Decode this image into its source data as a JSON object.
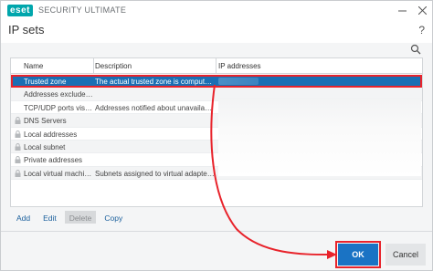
{
  "titlebar": {
    "logo_text": "eset",
    "app_title": "SECURITY ULTIMATE",
    "minimize_icon": "minimize-icon",
    "close_icon": "close-icon"
  },
  "header": {
    "title": "IP sets",
    "help_icon": "help-icon"
  },
  "search": {
    "icon": "search-icon"
  },
  "table": {
    "columns": [
      "Name",
      "Description",
      "IP addresses"
    ],
    "rows": [
      {
        "name": "Trusted zone",
        "description": "The actual trusted zone is computed fro...",
        "locked": false,
        "selected": true
      },
      {
        "name": "Addresses excluded fr...",
        "description": "",
        "locked": false,
        "selected": false
      },
      {
        "name": "TCP/UDP ports visibili...",
        "description": "Addresses notified about unavailability...",
        "locked": false,
        "selected": false
      },
      {
        "name": "DNS Servers",
        "description": "",
        "locked": true,
        "selected": false
      },
      {
        "name": "Local addresses",
        "description": "",
        "locked": true,
        "selected": false
      },
      {
        "name": "Local subnet",
        "description": "",
        "locked": true,
        "selected": false
      },
      {
        "name": "Private addresses",
        "description": "",
        "locked": true,
        "selected": false
      },
      {
        "name": "Local virtual machines",
        "description": "Subnets assigned to virtual adapters con...",
        "locked": true,
        "selected": false
      }
    ]
  },
  "toolbar": {
    "add_label": "Add",
    "edit_label": "Edit",
    "delete_label": "Delete",
    "copy_label": "Copy"
  },
  "footer": {
    "ok_label": "OK",
    "cancel_label": "Cancel"
  },
  "colors": {
    "accent": "#1a73c4",
    "selection": "#1a6fb4",
    "highlight": "#e8232b",
    "logo": "#00a6ac"
  }
}
